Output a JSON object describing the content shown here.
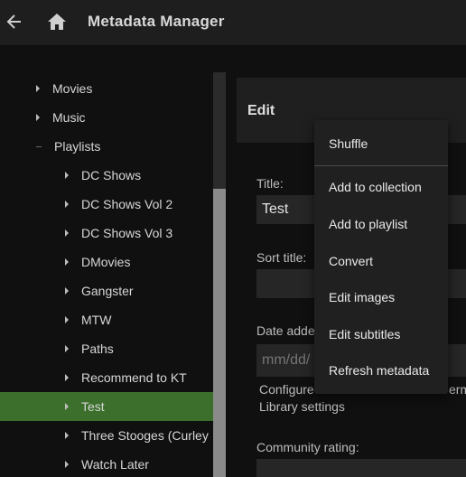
{
  "header": {
    "title": "Metadata Manager",
    "back_icon": "arrow-left-icon",
    "home_icon": "home-icon"
  },
  "sidebar": {
    "items": [
      {
        "label": "Movies",
        "level": 0,
        "expanded": false
      },
      {
        "label": "Music",
        "level": 0,
        "expanded": false
      },
      {
        "label": "Playlists",
        "level": 0,
        "expanded": true
      },
      {
        "label": "DC Shows",
        "level": 1
      },
      {
        "label": "DC Shows Vol 2",
        "level": 1
      },
      {
        "label": "DC Shows Vol 3",
        "level": 1
      },
      {
        "label": "DMovies",
        "level": 1
      },
      {
        "label": "Gangster",
        "level": 1
      },
      {
        "label": "MTW",
        "level": 1
      },
      {
        "label": "Paths",
        "level": 1
      },
      {
        "label": "Recommend to KT",
        "level": 1
      },
      {
        "label": "Test",
        "level": 1,
        "selected": true
      },
      {
        "label": "Three Stooges (Curley",
        "level": 1
      },
      {
        "label": "Watch Later",
        "level": 1
      }
    ],
    "selected_color": "#3b6f2b"
  },
  "editor": {
    "heading": "Edit",
    "title_label": "Title:",
    "title_value": "Test",
    "sort_title_label": "Sort title:",
    "sort_title_value": "",
    "date_added_label": "Date adde",
    "date_added_placeholder": "mm/dd/",
    "helper_line1": "Configure",
    "helper_line1_tail": "erm",
    "helper_line2": "Library settings",
    "community_rating_label": "Community rating:"
  },
  "context_menu": {
    "items": [
      "Shuffle",
      "Add to collection",
      "Add to playlist",
      "Convert",
      "Edit images",
      "Edit subtitles",
      "Refresh metadata"
    ]
  }
}
